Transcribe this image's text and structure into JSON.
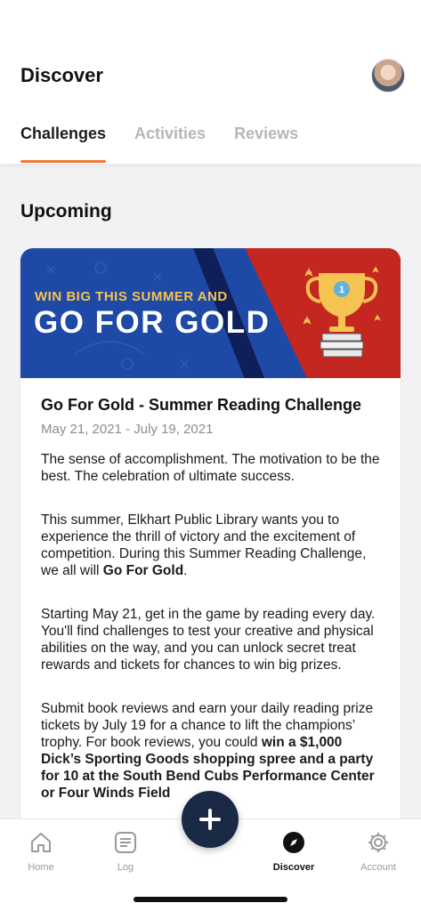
{
  "header": {
    "title": "Discover",
    "avatar_icon": "user-avatar"
  },
  "tabs": [
    {
      "label": "Challenges",
      "active": true
    },
    {
      "label": "Activities",
      "active": false
    },
    {
      "label": "Reviews",
      "active": false
    }
  ],
  "section": {
    "title": "Upcoming"
  },
  "card": {
    "banner": {
      "line1": "WIN BIG THIS SUMMER AND",
      "line2": "GO FOR GOLD",
      "trophy_number": "1"
    },
    "title": "Go For Gold - Summer Reading Challenge",
    "date": "May 21, 2021 - July 19, 2021",
    "paragraphs": {
      "p1": "The sense of accomplishment. The motivation to be the best. The celebration of ultimate success.",
      "p2_text": "This summer, Elkhart Public Library wants you to experience the thrill of victory and the excitement of competition. During this Summer Reading Challenge, we all will ",
      "p2_bold": "Go For Gold",
      "p2_end": ".",
      "p3": "Starting May 21, get in the game by reading every day. You'll find challenges to test your creative and physical abilities on the way, and you can unlock secret treat rewards and tickets for chances to win big prizes.",
      "p4_text": "Submit book reviews and earn your daily reading prize tickets by July 19 for a chance to lift the champions’ trophy. For book reviews, you could ",
      "p4_bold": "win a $1,000 Dick’s Sporting Goods shopping spree and a party for 10 at the South Bend Cubs Performance Center or Four Winds Field"
    }
  },
  "bottom_nav": {
    "items": [
      {
        "label": "Home",
        "icon": "home-icon"
      },
      {
        "label": "Log",
        "icon": "log-icon"
      },
      {
        "label": "Discover",
        "icon": "compass-icon",
        "active": true
      },
      {
        "label": "Account",
        "icon": "gear-icon"
      }
    ],
    "fab_icon": "plus-icon"
  },
  "colors": {
    "accent": "#ef7a34",
    "fab": "#1a2a44",
    "banner_blue": "#1f49a6",
    "banner_red": "#c3271f",
    "gold": "#f5c351"
  }
}
